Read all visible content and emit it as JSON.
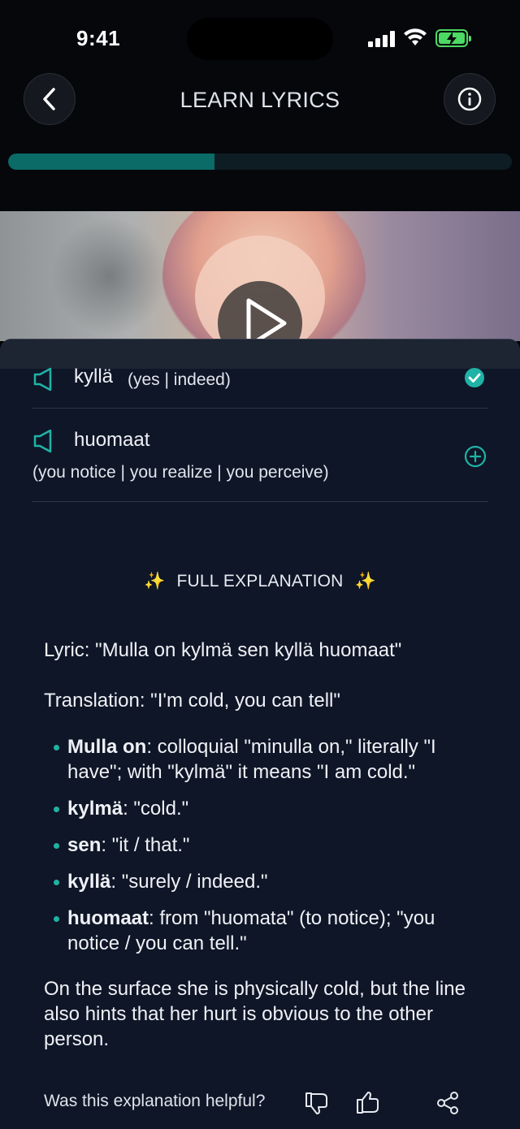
{
  "status_bar": {
    "time": "9:41"
  },
  "header": {
    "title": "LEARN LYRICS",
    "progress": 0.41
  },
  "vocab": [
    {
      "word": "kyllä",
      "gloss": "(yes | indeed)",
      "state": "added"
    },
    {
      "word": "huomaat",
      "gloss": "(you notice | you realize | you perceive)",
      "state": "add"
    }
  ],
  "explanation": {
    "heading": "FULL EXPLANATION",
    "spark": "✨",
    "lyric": "Lyric: \"Mulla on kylmä sen kyllä huomaat\"",
    "translation": "Translation: \"I'm cold, you can tell\"",
    "bullets": [
      {
        "term": "Mulla on",
        "text": ": colloquial \"minulla on,\" literally \"I have\"; with \"kylmä\" it means \"I am cold.\""
      },
      {
        "term": "kylmä",
        "text": ": \"cold.\""
      },
      {
        "term": "sen",
        "text": ": \"it / that.\""
      },
      {
        "term": "kyllä",
        "text": ": \"surely / indeed.\""
      },
      {
        "term": "huomaat",
        "text": ": from \"huomata\" (to notice); \"you notice / you can tell.\""
      }
    ],
    "summary": "On the surface she is physically cold, but the line also hints that her hurt is obvious to the other person."
  },
  "feedback": {
    "question": "Was this explanation helpful?"
  },
  "colors": {
    "accent": "#1fb3a6",
    "background": "#0f1627",
    "progress": "#0b6b67"
  }
}
